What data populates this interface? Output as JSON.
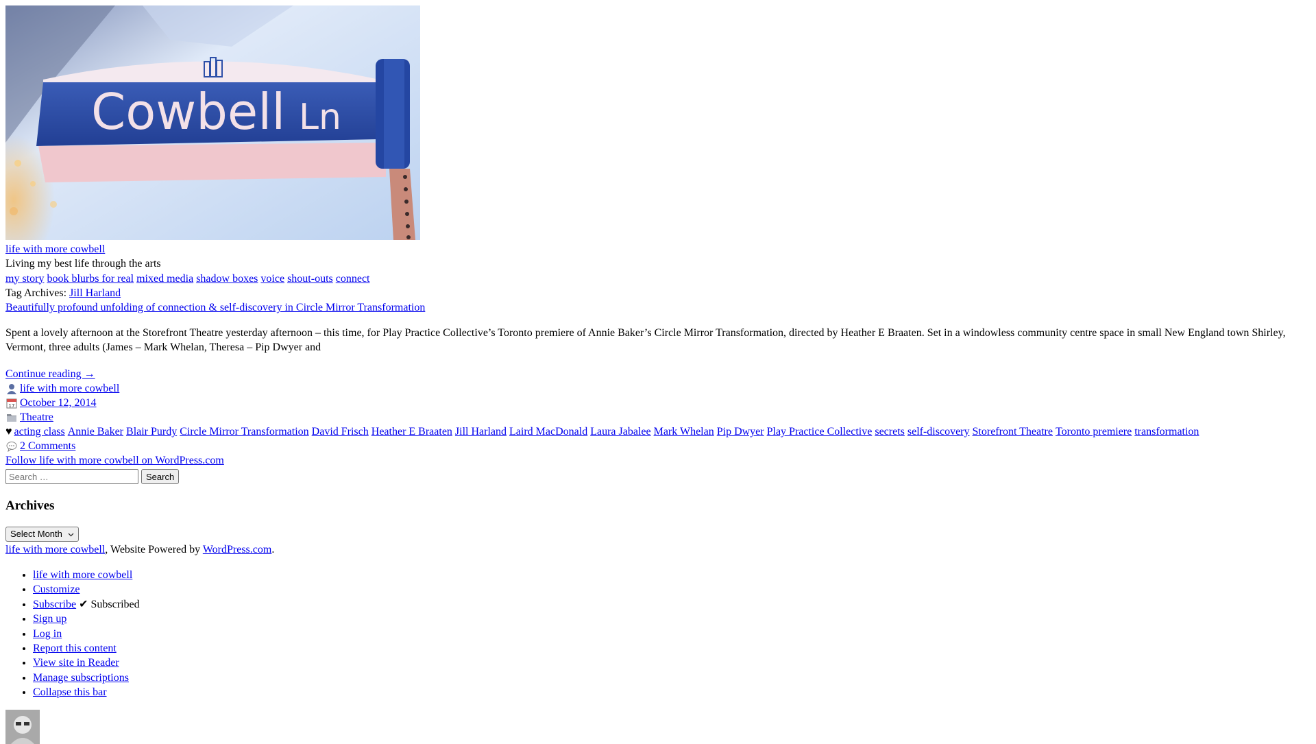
{
  "header_image": {
    "alt_description": "Cowbell Ln street sign",
    "sign_text_main": "Cowbell",
    "sign_text_suffix": "Ln",
    "colors": {
      "sky": "#cfe0f5",
      "sign": "#2d4fa8",
      "post": "#c98a7a"
    }
  },
  "site": {
    "title": "life with more cowbell",
    "tagline": "Living my best life through the arts"
  },
  "nav": [
    "my story",
    "book blurbs for real",
    "mixed media",
    "shadow boxes",
    "voice",
    "shout-outs",
    "connect"
  ],
  "archive": {
    "prefix": "Tag Archives:",
    "tag": "Jill Harland"
  },
  "post": {
    "title": "Beautifully profound unfolding of connection & self-discovery in Circle Mirror Transformation",
    "excerpt": "Spent a lovely afternoon at the Storefront Theatre yesterday afternoon – this time, for Play Practice Collective’s Toronto premiere of Annie Baker’s Circle Mirror Transformation, directed by Heather E Braaten. Set in a windowless community centre space in small New England town Shirley, Vermont, three adults (James – Mark Whelan, Theresa – Pip Dwyer and",
    "continue": "Continue reading →",
    "author": "life with more cowbell",
    "date": "October 12, 2014",
    "category": "Theatre",
    "tags": [
      "acting class",
      "Annie Baker",
      "Blair Purdy",
      "Circle Mirror Transformation",
      "David Frisch",
      "Heather E Braaten",
      "Jill Harland",
      "Laird MacDonald",
      "Laura Jabalee",
      "Mark Whelan",
      "Pip Dwyer",
      "Play Practice Collective",
      "secrets",
      "self-discovery",
      "Storefront Theatre",
      "Toronto premiere",
      "transformation"
    ],
    "comments": "2 Comments"
  },
  "icons": {
    "author": "person-icon",
    "date": "calendar-icon",
    "category": "folder-icon",
    "tags": "heart-icon",
    "comments": "speech-bubble-icon",
    "heart_glyph": "♥"
  },
  "follow_link": "Follow life with more cowbell on WordPress.com",
  "search": {
    "placeholder": "Search …",
    "button": "Search"
  },
  "archives": {
    "heading": "Archives",
    "select_value": "Select Month"
  },
  "footer": {
    "site_link": "life with more cowbell",
    "powered_text": ", Website Powered by ",
    "wp_link": "WordPress.com",
    "end": "."
  },
  "admin_bar": {
    "items": [
      "life with more cowbell",
      "Customize",
      "Subscribe",
      "Sign up",
      "Log in",
      "Report this content",
      "View site in Reader",
      "Manage subscriptions",
      "Collapse this bar"
    ],
    "subscribed_label": "✔ Subscribed"
  }
}
